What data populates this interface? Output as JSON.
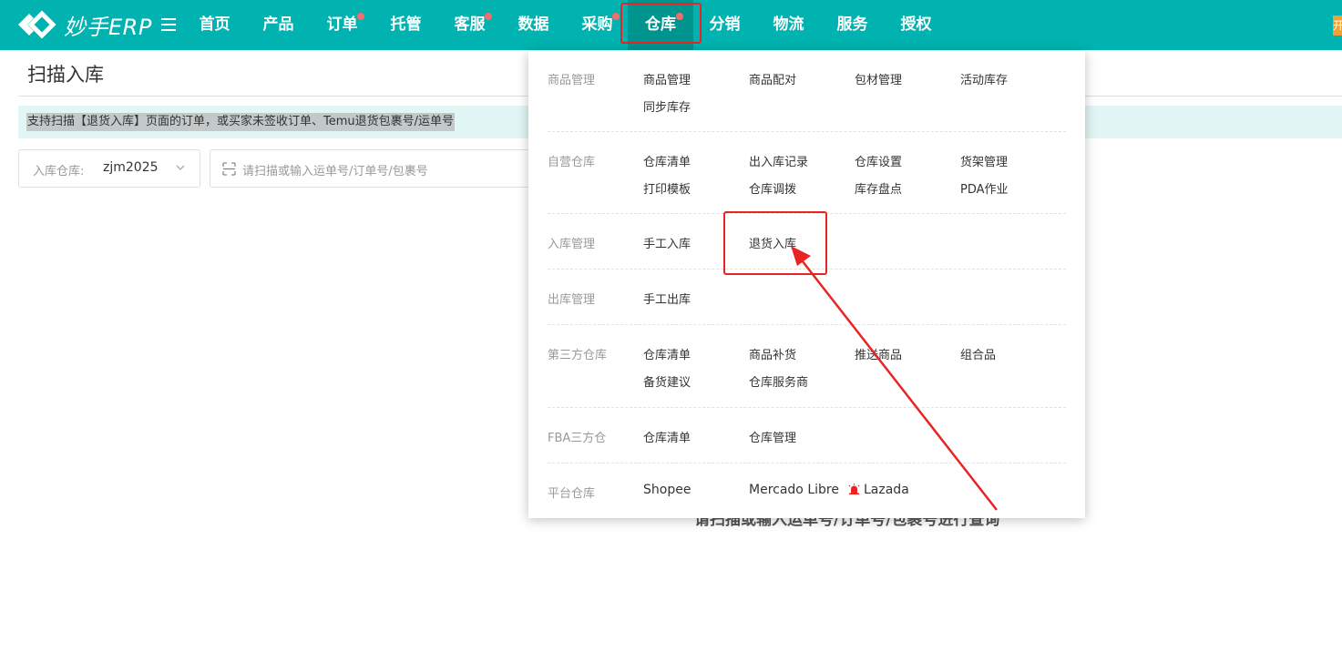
{
  "header": {
    "logo_text": "妙手ERP",
    "nav": [
      {
        "label": "首页"
      },
      {
        "label": "产品"
      },
      {
        "label": "订单"
      },
      {
        "label": "托管"
      },
      {
        "label": "客服"
      },
      {
        "label": "数据"
      },
      {
        "label": "采购"
      },
      {
        "label": "仓库"
      },
      {
        "label": "分销"
      },
      {
        "label": "物流"
      },
      {
        "label": "服务"
      },
      {
        "label": "授权"
      }
    ],
    "corner_badge": "开"
  },
  "page": {
    "title": "扫描入库",
    "notice": "支持扫描【退货入库】页面的订单，或买家未签收订单、Temu退货包裹号/运单号",
    "warehouse_label": "入库仓库:",
    "warehouse_value": "zjm2025",
    "scan_placeholder": "请扫描或输入运单号/订单号/包裹号",
    "bg_hint": "请扫描或输入运单号/订单号/包裹号进行查询"
  },
  "menu": {
    "sections": [
      {
        "title": "商品管理",
        "links": [
          "商品管理",
          "商品配对",
          "包材管理",
          "活动库存",
          "同步库存"
        ]
      },
      {
        "title": "自营仓库",
        "links": [
          "仓库清单",
          "出入库记录",
          "仓库设置",
          "货架管理",
          "打印模板",
          "仓库调拨",
          "库存盘点",
          "PDA作业"
        ]
      },
      {
        "title": "入库管理",
        "links": [
          "手工入库",
          "退货入库"
        ]
      },
      {
        "title": "出库管理",
        "links": [
          "手工出库"
        ]
      },
      {
        "title": "第三方仓库",
        "links": [
          "仓库清单",
          "商品补货",
          "推送商品",
          "组合品",
          "备货建议",
          "仓库服务商"
        ]
      },
      {
        "title": "FBA三方仓",
        "links": [
          "仓库清单",
          "仓库管理"
        ]
      },
      {
        "title": "平台仓库",
        "links": [
          "Shopee",
          "Mercado Libre",
          "Lazada"
        ]
      }
    ]
  },
  "colors": {
    "brand": "#00b3b0",
    "active_nav": "#00948f",
    "badge_dot": "#f56c6c",
    "annotation": "#e82424"
  }
}
